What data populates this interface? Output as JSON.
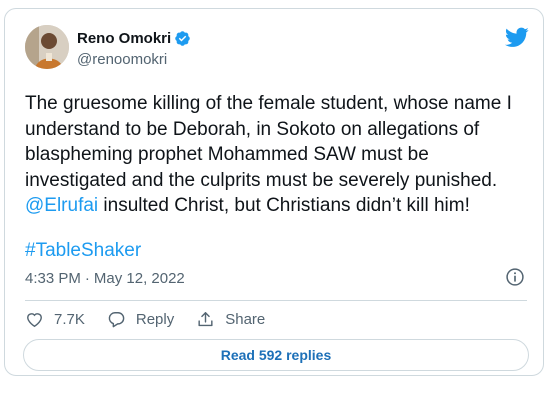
{
  "author": {
    "name": "Reno Omokri",
    "handle": "@renoomokri",
    "verified": true
  },
  "tweet": {
    "text_before_mention": "The gruesome killing of the female student, whose name I understand to be Deborah, in Sokoto on allegations of blaspheming prophet Mohammed SAW must be investigated and the culprits must be severely punished.",
    "mention": "@Elrufai",
    "text_after_mention": " insulted Christ, but Christians didn’t kill him!",
    "hashtag": "#TableShaker",
    "time": "4:33 PM",
    "separator": "·",
    "date": "May 12, 2022"
  },
  "actions": {
    "like_count": "7.7K",
    "reply_label": "Reply",
    "share_label": "Share"
  },
  "read_replies_label": "Read 592 replies",
  "icons": {
    "brand": "twitter-bird-icon",
    "verified": "verified-badge-icon",
    "info": "info-icon",
    "like": "heart-icon",
    "reply": "reply-icon",
    "share": "share-icon"
  },
  "colors": {
    "accent": "#1d9bf0",
    "text": "#0f1419",
    "muted": "#536471",
    "border": "#cfd9de"
  }
}
